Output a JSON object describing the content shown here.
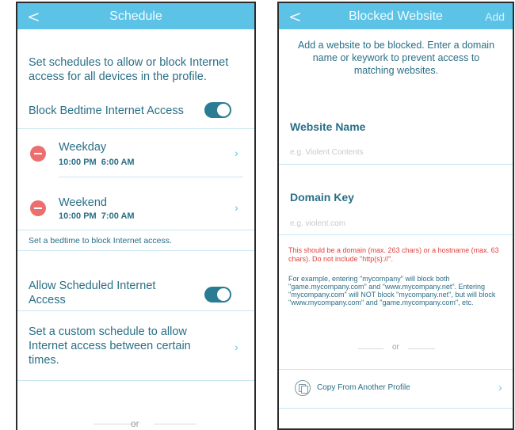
{
  "left": {
    "header": {
      "back": "<",
      "title": "Schedule"
    },
    "intro": "Set schedules to allow or block Internet access for all devices in the profile.",
    "bedtime_toggle_label": "Block Bedtime Internet Access",
    "bedtime_enabled": true,
    "schedules": [
      {
        "name": "Weekday",
        "time": "10:00 PM  6:00 AM"
      },
      {
        "name": "Weekend",
        "time": "10:00 PM  7:00 AM"
      }
    ],
    "bedtime_note": "Set a bedtime to block Internet access.",
    "scheduled_toggle_label": "Allow Scheduled Internet Access",
    "scheduled_enabled": true,
    "custom_text": "Set a custom schedule to allow Internet access between certain times.",
    "or": "or"
  },
  "right": {
    "header": {
      "back": "<",
      "title": "Blocked Website",
      "add": "Add"
    },
    "intro": "Add a website to be blocked. Enter a domain name or keywork to prevent access to matching websites.",
    "website_name_label": "Website Name",
    "website_name_placeholder": "e.g. Violent Contents",
    "domain_key_label": "Domain Key",
    "domain_key_placeholder": "e.g. violent.com",
    "warning": "This should be a domain (max. 263 chars) or a hostname (max. 63 chars). Do not include \"http(s)://\".",
    "example": "For example, entering \"mycompany\" will block both \"game.mycompany.com\" and \"www.mycompany.net\". Entering \"mycompany.com\" will NOT block \"mycompany.net\", but will block \"www.mycompany.com\" and \"game.mycompany.com\", etc.",
    "or": "or",
    "copy_label": "Copy From Another Profile"
  },
  "colors": {
    "header": "#5cc3e6",
    "text": "#2a6f86",
    "toggle": "#2a7c93",
    "remove": "#ec6f6f",
    "warning": "#e0413c"
  },
  "icons": [
    "back-icon",
    "remove-icon",
    "chevron-right-icon",
    "copy-icon"
  ]
}
